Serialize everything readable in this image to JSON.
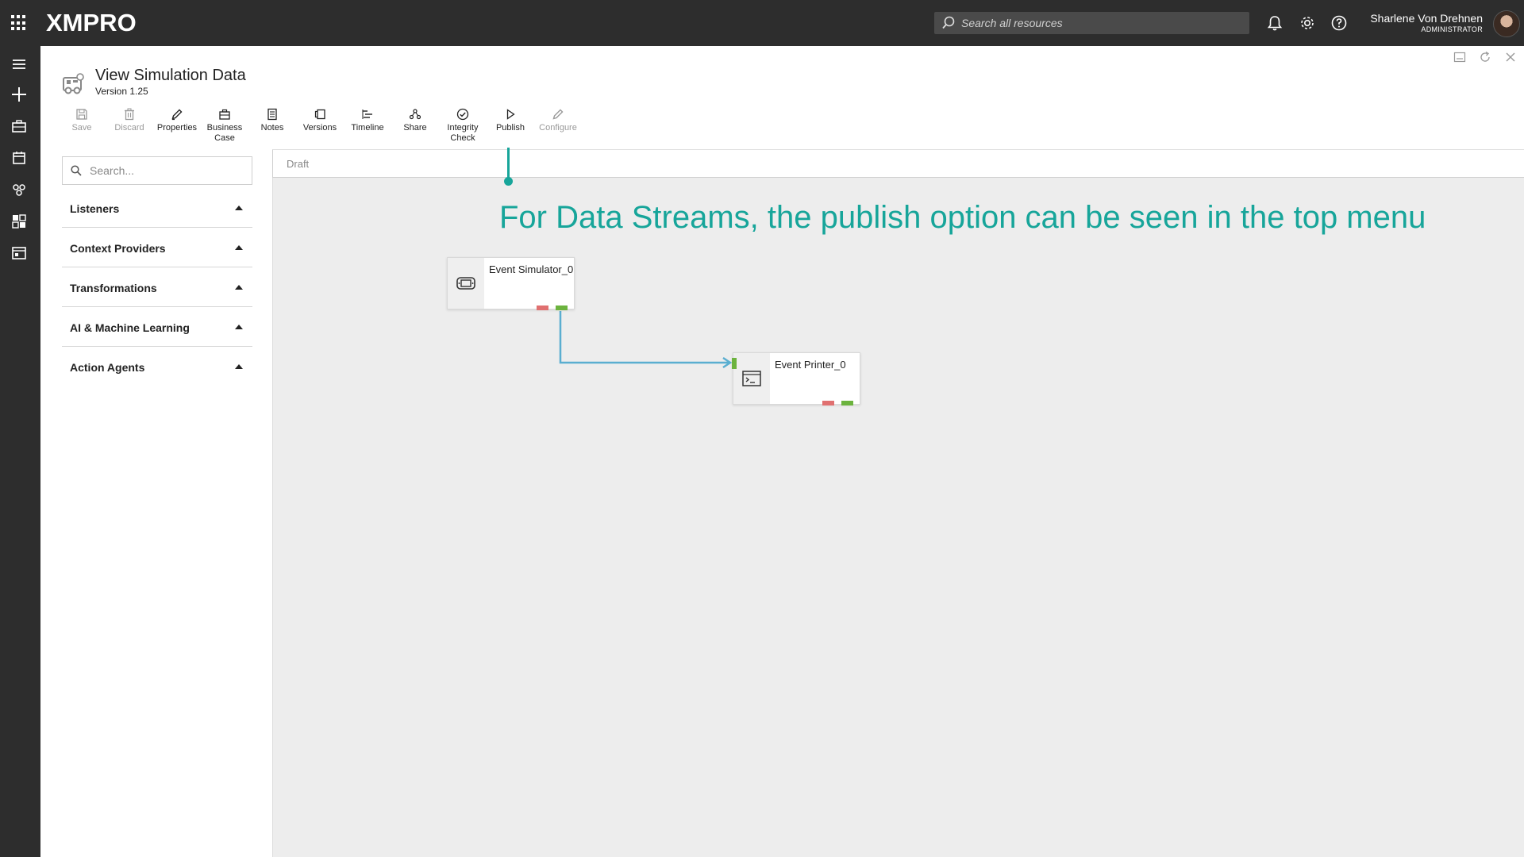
{
  "topbar": {
    "brand": "XMPRO",
    "search_placeholder": "Search all resources",
    "user_name": "Sharlene Von Drehnen",
    "user_role": "ADMINISTRATOR"
  },
  "page": {
    "title": "View Simulation Data",
    "version": "Version 1.25"
  },
  "toolbar": {
    "save": "Save",
    "discard": "Discard",
    "properties": "Properties",
    "business_case_1": "Business",
    "business_case_2": "Case",
    "notes": "Notes",
    "versions": "Versions",
    "timeline": "Timeline",
    "share": "Share",
    "integrity_1": "Integrity",
    "integrity_2": "Check",
    "publish": "Publish",
    "configure": "Configure"
  },
  "panel": {
    "search_placeholder": "Search...",
    "categories": [
      "Listeners",
      "Context Providers",
      "Transformations",
      "AI & Machine Learning",
      "Action Agents"
    ]
  },
  "canvas": {
    "status": "Draft",
    "annotation": "For Data Streams, the publish option can be seen in the top menu",
    "nodes": [
      "Event Simulator_0",
      "Event Printer_0"
    ]
  },
  "colors": {
    "accent": "#17a59a",
    "connector": "#5aaed0",
    "port_out_error": "#e07070",
    "port_out_ok": "#6cb33e"
  },
  "icons": {
    "rail": [
      "menu-icon",
      "plus-icon",
      "briefcase-icon",
      "calendar-icon",
      "stream-icon",
      "dashboard-icon",
      "app-icon"
    ]
  }
}
